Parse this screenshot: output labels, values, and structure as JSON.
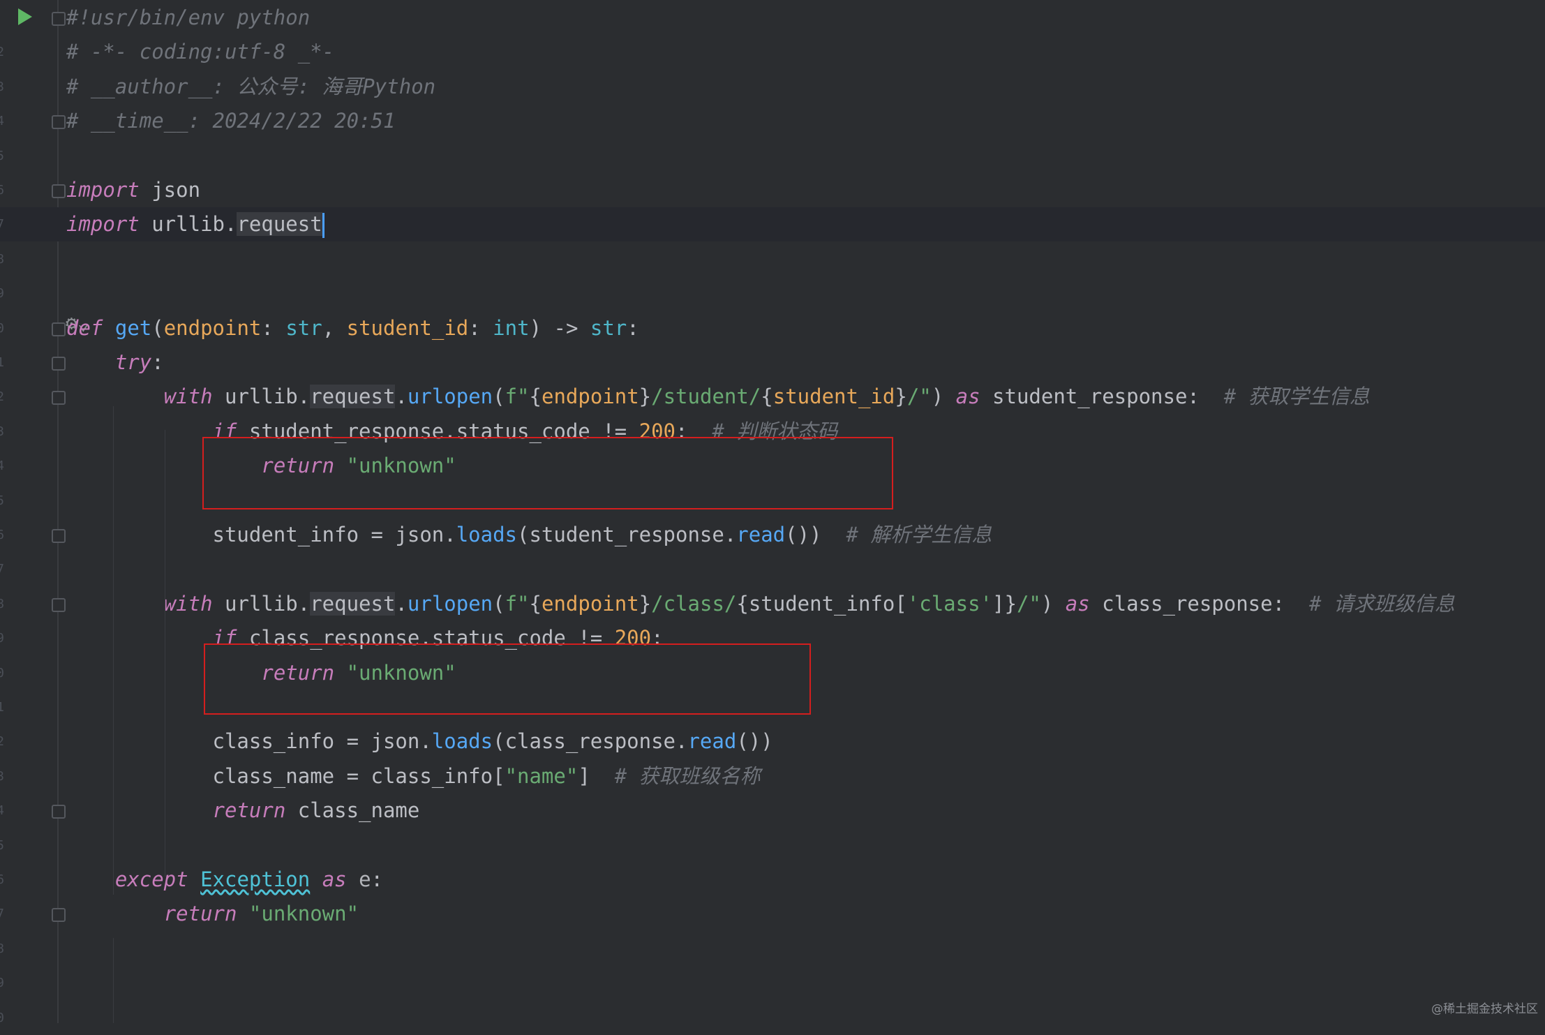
{
  "editor": {
    "language": "python",
    "line_numbers": [
      "",
      "2",
      "3",
      "4",
      "5",
      "6",
      "7",
      "8",
      "9",
      "0",
      "1",
      "2",
      "3",
      "4",
      "5",
      "6",
      "7",
      "8",
      "9",
      "0",
      "1",
      "2",
      "3",
      "4",
      "5",
      "6",
      "7",
      "8",
      "9",
      "0"
    ],
    "lines": [
      {
        "id": "l1",
        "tokens": [
          {
            "c": "cm",
            "t": "#!usr/bin/env python"
          }
        ]
      },
      {
        "id": "l2",
        "tokens": [
          {
            "c": "cm",
            "t": "# -*- coding:utf-8 _*-"
          }
        ]
      },
      {
        "id": "l3",
        "tokens": [
          {
            "c": "cm",
            "t": "# __author__: 公众号: 海哥Python"
          }
        ]
      },
      {
        "id": "l4",
        "tokens": [
          {
            "c": "cm",
            "t": "# __time__: 2024/2/22 20:51"
          }
        ]
      },
      {
        "id": "l5",
        "tokens": []
      },
      {
        "id": "l6",
        "tokens": [
          {
            "c": "kw",
            "t": "import"
          },
          {
            "c": "",
            "t": " json"
          }
        ]
      },
      {
        "id": "l7",
        "tokens": [
          {
            "c": "kw",
            "t": "import"
          },
          {
            "c": "",
            "t": " urllib."
          },
          {
            "c": "ref",
            "t": "request"
          }
        ]
      },
      {
        "id": "l8",
        "tokens": []
      },
      {
        "id": "l9",
        "tokens": []
      },
      {
        "id": "l10",
        "tokens": [
          {
            "c": "kw",
            "t": "def"
          },
          {
            "c": "",
            "t": " "
          },
          {
            "c": "fn",
            "t": "get"
          },
          {
            "c": "",
            "t": "("
          },
          {
            "c": "param",
            "t": "endpoint"
          },
          {
            "c": "",
            "t": ": "
          },
          {
            "c": "builtin",
            "t": "str"
          },
          {
            "c": "",
            "t": ", "
          },
          {
            "c": "param",
            "t": "student_id"
          },
          {
            "c": "",
            "t": ": "
          },
          {
            "c": "builtin",
            "t": "int"
          },
          {
            "c": "",
            "t": ") -> "
          },
          {
            "c": "builtin",
            "t": "str"
          },
          {
            "c": "",
            "t": ":"
          }
        ]
      },
      {
        "id": "l11",
        "tokens": [
          {
            "c": "",
            "t": "    "
          },
          {
            "c": "kw",
            "t": "try"
          },
          {
            "c": "",
            "t": ":"
          }
        ]
      },
      {
        "id": "l12",
        "tokens": [
          {
            "c": "",
            "t": "        "
          },
          {
            "c": "kw",
            "t": "with"
          },
          {
            "c": "",
            "t": " urllib."
          },
          {
            "c": "ref",
            "t": "request"
          },
          {
            "c": "",
            "t": "."
          },
          {
            "c": "fn",
            "t": "urlopen"
          },
          {
            "c": "",
            "t": "("
          },
          {
            "c": "str",
            "t": "f\""
          },
          {
            "c": "",
            "t": "{"
          },
          {
            "c": "param",
            "t": "endpoint"
          },
          {
            "c": "",
            "t": "}"
          },
          {
            "c": "str",
            "t": "/student/"
          },
          {
            "c": "",
            "t": "{"
          },
          {
            "c": "param",
            "t": "student_id"
          },
          {
            "c": "",
            "t": "}"
          },
          {
            "c": "str",
            "t": "/\""
          },
          {
            "c": "",
            "t": ") "
          },
          {
            "c": "kw",
            "t": "as"
          },
          {
            "c": "",
            "t": " student_response:  "
          },
          {
            "c": "cm",
            "t": "# 获取学生信息"
          }
        ]
      },
      {
        "id": "l13",
        "tokens": [
          {
            "c": "",
            "t": "            "
          },
          {
            "c": "kw",
            "t": "if"
          },
          {
            "c": "",
            "t": " student_response.status_code != "
          },
          {
            "c": "num",
            "t": "200"
          },
          {
            "c": "",
            "t": ":  "
          },
          {
            "c": "cm",
            "t": "# 判断状态码"
          }
        ]
      },
      {
        "id": "l14",
        "tokens": [
          {
            "c": "",
            "t": "                "
          },
          {
            "c": "kw",
            "t": "return"
          },
          {
            "c": "",
            "t": " "
          },
          {
            "c": "str",
            "t": "\"unknown\""
          }
        ]
      },
      {
        "id": "l15",
        "tokens": []
      },
      {
        "id": "l16",
        "tokens": [
          {
            "c": "",
            "t": "            student_info = json."
          },
          {
            "c": "fn",
            "t": "loads"
          },
          {
            "c": "",
            "t": "(student_response."
          },
          {
            "c": "fn",
            "t": "read"
          },
          {
            "c": "",
            "t": "())  "
          },
          {
            "c": "cm",
            "t": "# 解析学生信息"
          }
        ]
      },
      {
        "id": "l17",
        "tokens": []
      },
      {
        "id": "l18",
        "tokens": [
          {
            "c": "",
            "t": "        "
          },
          {
            "c": "kw",
            "t": "with"
          },
          {
            "c": "",
            "t": " urllib."
          },
          {
            "c": "ref",
            "t": "request"
          },
          {
            "c": "",
            "t": "."
          },
          {
            "c": "fn",
            "t": "urlopen"
          },
          {
            "c": "",
            "t": "("
          },
          {
            "c": "str",
            "t": "f\""
          },
          {
            "c": "",
            "t": "{"
          },
          {
            "c": "param",
            "t": "endpoint"
          },
          {
            "c": "",
            "t": "}"
          },
          {
            "c": "str",
            "t": "/class/"
          },
          {
            "c": "",
            "t": "{student_info["
          },
          {
            "c": "str",
            "t": "'class'"
          },
          {
            "c": "",
            "t": "]}"
          },
          {
            "c": "str",
            "t": "/\""
          },
          {
            "c": "",
            "t": ") "
          },
          {
            "c": "kw",
            "t": "as"
          },
          {
            "c": "",
            "t": " class_response:  "
          },
          {
            "c": "cm",
            "t": "# 请求班级信息"
          }
        ]
      },
      {
        "id": "l19",
        "tokens": [
          {
            "c": "",
            "t": "            "
          },
          {
            "c": "kw",
            "t": "if"
          },
          {
            "c": "",
            "t": " class_response.status_code != "
          },
          {
            "c": "num",
            "t": "200"
          },
          {
            "c": "",
            "t": ":"
          }
        ]
      },
      {
        "id": "l20",
        "tokens": [
          {
            "c": "",
            "t": "                "
          },
          {
            "c": "kw",
            "t": "return"
          },
          {
            "c": "",
            "t": " "
          },
          {
            "c": "str",
            "t": "\"unknown\""
          }
        ]
      },
      {
        "id": "l21",
        "tokens": []
      },
      {
        "id": "l22",
        "tokens": [
          {
            "c": "",
            "t": "            class_info = json."
          },
          {
            "c": "fn",
            "t": "loads"
          },
          {
            "c": "",
            "t": "(class_response."
          },
          {
            "c": "fn",
            "t": "read"
          },
          {
            "c": "",
            "t": "())"
          }
        ]
      },
      {
        "id": "l23",
        "tokens": [
          {
            "c": "",
            "t": "            class_name = class_info["
          },
          {
            "c": "str",
            "t": "\"name\""
          },
          {
            "c": "",
            "t": "]  "
          },
          {
            "c": "cm",
            "t": "# 获取班级名称"
          }
        ]
      },
      {
        "id": "l24",
        "tokens": [
          {
            "c": "",
            "t": "            "
          },
          {
            "c": "kw",
            "t": "return"
          },
          {
            "c": "",
            "t": " class_name"
          }
        ]
      },
      {
        "id": "l25",
        "tokens": []
      },
      {
        "id": "l26",
        "tokens": [
          {
            "c": "",
            "t": "    "
          },
          {
            "c": "kw",
            "t": "except"
          },
          {
            "c": "",
            "t": " "
          },
          {
            "c": "exc",
            "t": "Exception"
          },
          {
            "c": "",
            "t": " "
          },
          {
            "c": "kw",
            "t": "as"
          },
          {
            "c": "dim",
            "t": " e"
          },
          {
            "c": "",
            "t": ":"
          }
        ]
      },
      {
        "id": "l27",
        "tokens": [
          {
            "c": "",
            "t": "        "
          },
          {
            "c": "kw",
            "t": "return"
          },
          {
            "c": "",
            "t": " "
          },
          {
            "c": "str",
            "t": "\"unknown\""
          }
        ]
      },
      {
        "id": "l28",
        "tokens": []
      },
      {
        "id": "l29",
        "tokens": []
      },
      {
        "id": "l30",
        "tokens": []
      }
    ]
  },
  "watermark": "@稀土掘金技术社区",
  "colors": {
    "background": "#2b2d30",
    "keyword": "#c77dbb",
    "comment": "#6f737a",
    "string": "#6aab73",
    "number": "#e8a85a",
    "function": "#56a8f5",
    "highlight_box": "#d41e1e"
  }
}
